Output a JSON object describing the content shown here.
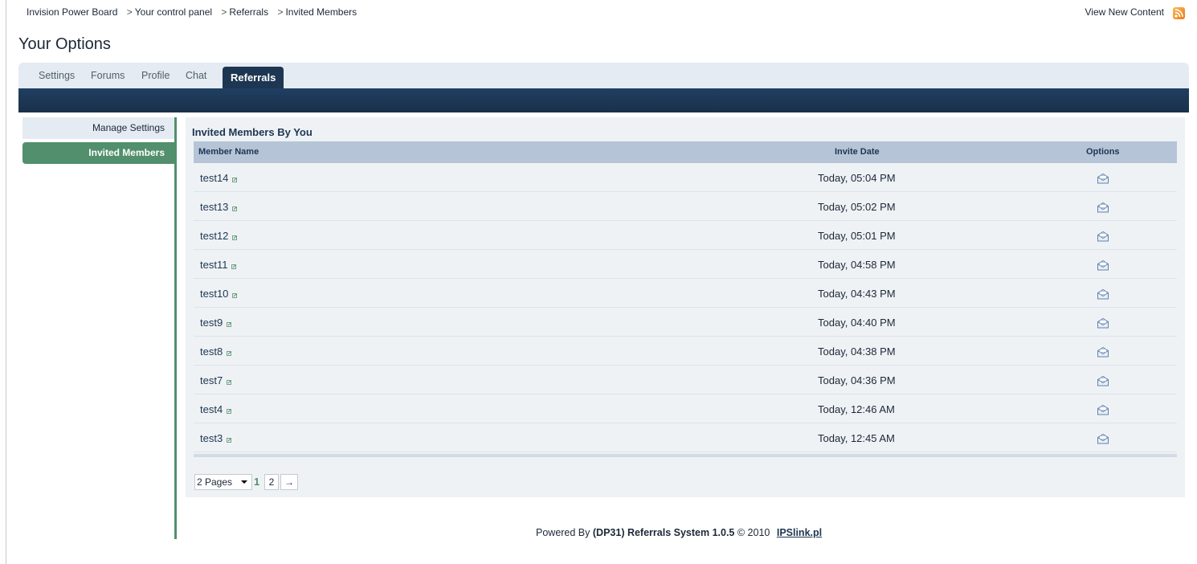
{
  "breadcrumb": [
    "Invision Power Board",
    "Your control panel",
    "Referrals",
    "Invited Members"
  ],
  "breadcrumb_separator": ">",
  "header": {
    "view_new_content": "View New Content",
    "rss_icon": "rss-icon"
  },
  "page_title": "Your Options",
  "tabs": {
    "settings": "Settings",
    "forums": "Forums",
    "profile": "Profile",
    "chat": "Chat",
    "referrals": "Referrals"
  },
  "sidebar": {
    "manage_settings": "Manage Settings",
    "invited_members": "Invited Members"
  },
  "panel": {
    "title": "Invited Members By You",
    "columns": {
      "member_name": "Member Name",
      "invite_date": "Invite Date",
      "options": "Options"
    },
    "rows": [
      {
        "name": "test14",
        "date": "Today, 05:04 PM"
      },
      {
        "name": "test13",
        "date": "Today, 05:02 PM"
      },
      {
        "name": "test12",
        "date": "Today, 05:01 PM"
      },
      {
        "name": "test11",
        "date": "Today, 04:58 PM"
      },
      {
        "name": "test10",
        "date": "Today, 04:43 PM"
      },
      {
        "name": "test9",
        "date": "Today, 04:40 PM"
      },
      {
        "name": "test8",
        "date": "Today, 04:38 PM"
      },
      {
        "name": "test7",
        "date": "Today, 04:36 PM"
      },
      {
        "name": "test4",
        "date": "Today, 12:46 AM"
      },
      {
        "name": "test3",
        "date": "Today, 12:45 AM"
      }
    ]
  },
  "pagination": {
    "pages_label": "2 Pages",
    "current": "1",
    "page2": "2",
    "next": "→"
  },
  "footer": {
    "powered_by": "Powered By",
    "product": "(DP31) Referrals System 1.0.5",
    "copyright": "© 2010",
    "link": "IPSlink.pl"
  },
  "colors": {
    "accent_green": "#528f6c",
    "dark_blue": "#1d3652",
    "tab_bg": "#e4ebf2",
    "table_header": "#b5c4d7"
  }
}
